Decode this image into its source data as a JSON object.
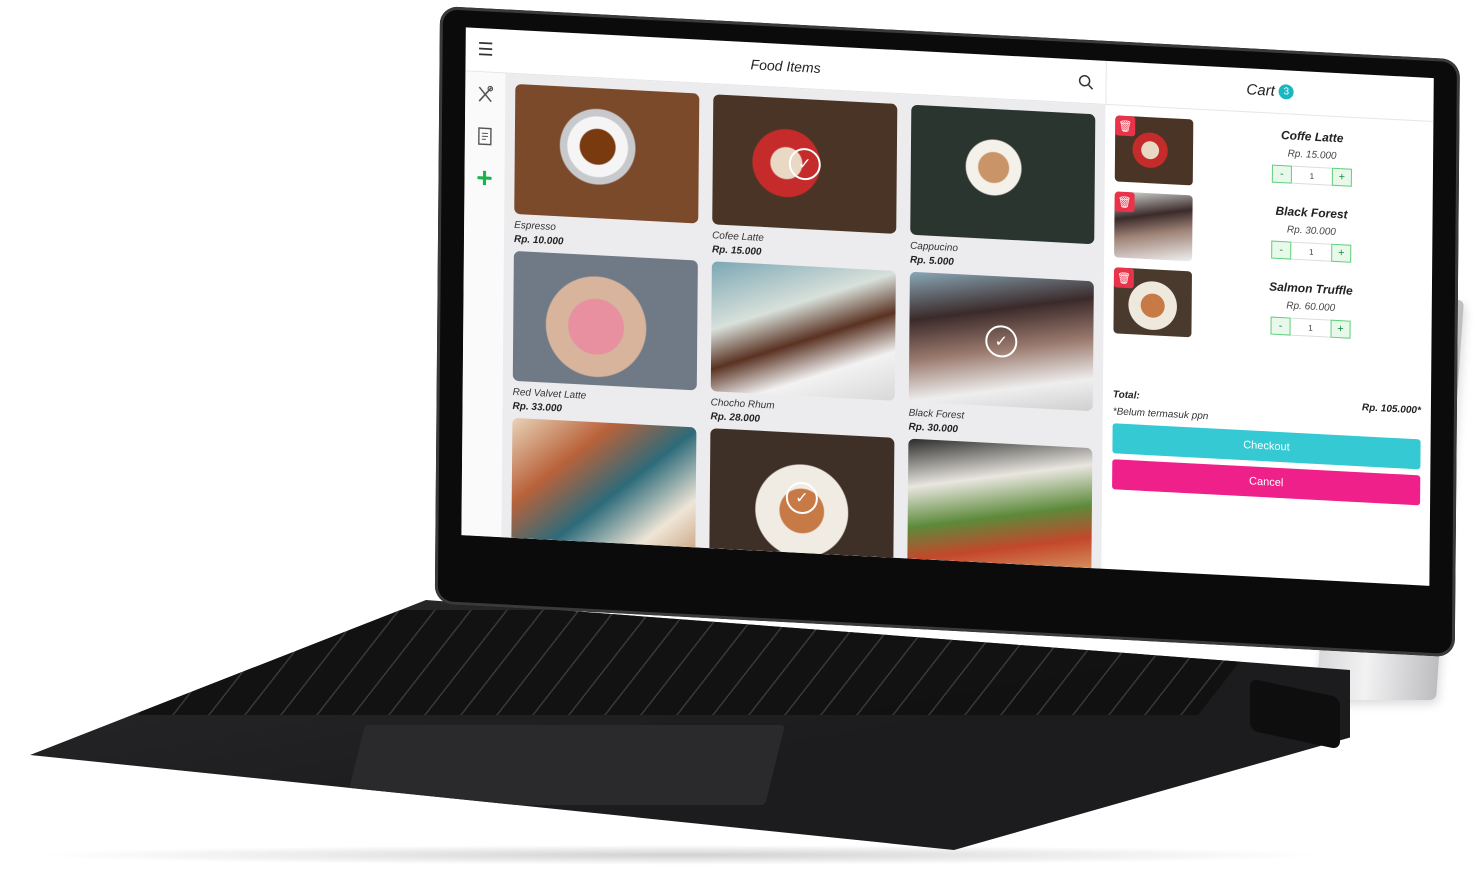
{
  "header": {
    "title": "Food Items"
  },
  "cart": {
    "title": "Cart",
    "count": "3",
    "items": [
      {
        "name": "Coffe Latte",
        "price": "Rp. 15.000",
        "qty": "1",
        "minus": "-",
        "plus": "+"
      },
      {
        "name": "Black Forest",
        "price": "Rp. 30.000",
        "qty": "1",
        "minus": "-",
        "plus": "+"
      },
      {
        "name": "Salmon Truffle",
        "price": "Rp. 60.000",
        "qty": "1",
        "minus": "-",
        "plus": "+"
      }
    ],
    "total_label": "Total:",
    "total_value": "Rp. 105.000*",
    "note": "*Belum termasuk ppn",
    "checkout_label": "Checkout",
    "cancel_label": "Cancel"
  },
  "products": [
    {
      "name": "Espresso",
      "price": "Rp. 10.000",
      "selected": false
    },
    {
      "name": "Cofee Latte",
      "price": "Rp. 15.000",
      "selected": true
    },
    {
      "name": "Cappucino",
      "price": "Rp. 5.000",
      "selected": false
    },
    {
      "name": "Red Valvet Latte",
      "price": "Rp. 33.000",
      "selected": false
    },
    {
      "name": "Chocho Rhum",
      "price": "Rp. 28.000",
      "selected": false
    },
    {
      "name": "Black Forest",
      "price": "Rp. 30.000",
      "selected": true
    },
    {
      "name": "",
      "price": "",
      "selected": false
    },
    {
      "name": "",
      "price": "",
      "selected": true
    },
    {
      "name": "",
      "price": "",
      "selected": false
    }
  ],
  "icons": {
    "menu": "hamburger-menu-icon",
    "search": "search-icon",
    "nav_food": "fork-spoon-icon",
    "nav_orders": "receipt-icon",
    "nav_add": "plus-icon",
    "trash": "trash-icon",
    "check": "check-circle-icon"
  },
  "colors": {
    "accent_teal": "#35c9d3",
    "accent_pink": "#f0208b",
    "delete_red": "#e8334a",
    "add_green": "#19b34a"
  }
}
